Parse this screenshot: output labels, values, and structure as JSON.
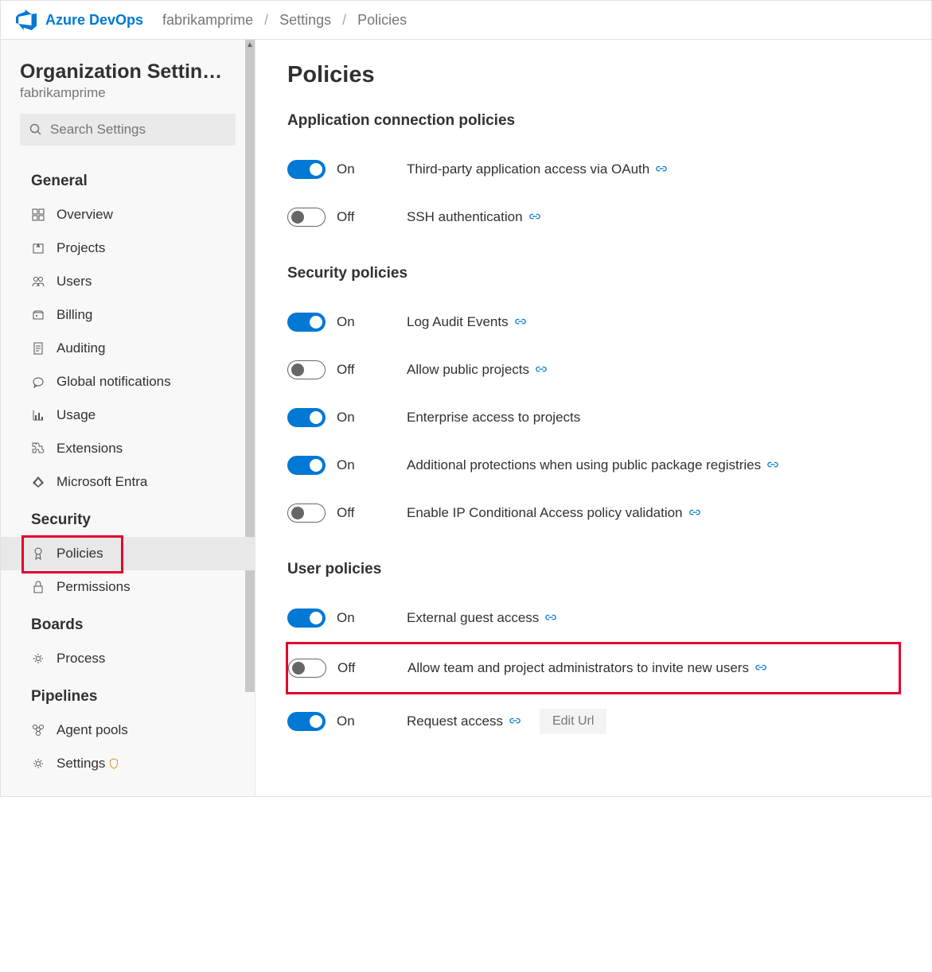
{
  "breadcrumb": {
    "product": "Azure DevOps",
    "org": "fabrikamprime",
    "settings": "Settings",
    "policies": "Policies"
  },
  "sidebar": {
    "title": "Organization Settin…",
    "subtitle": "fabrikamprime",
    "search_placeholder": "Search Settings",
    "sections": {
      "general": "General",
      "security": "Security",
      "boards": "Boards",
      "pipelines": "Pipelines"
    },
    "items": {
      "overview": "Overview",
      "projects": "Projects",
      "users": "Users",
      "billing": "Billing",
      "auditing": "Auditing",
      "global_notifications": "Global notifications",
      "usage": "Usage",
      "extensions": "Extensions",
      "entra": "Microsoft Entra",
      "policies": "Policies",
      "permissions": "Permissions",
      "process": "Process",
      "agent_pools": "Agent pools",
      "settings": "Settings"
    }
  },
  "main": {
    "title": "Policies",
    "sections": {
      "app_conn": "Application connection policies",
      "security": "Security policies",
      "user": "User policies"
    },
    "toggle_on": "On",
    "toggle_off": "Off",
    "policies": {
      "oauth": "Third-party application access via OAuth",
      "ssh": "SSH authentication",
      "audit": "Log Audit Events",
      "public_projects": "Allow public projects",
      "enterprise_access": "Enterprise access to projects",
      "package_registries": "Additional protections when using public package registries",
      "ip_ca": "Enable IP Conditional Access policy validation",
      "guest_access": "External guest access",
      "invite_users": "Allow team and project administrators to invite new users",
      "request_access": "Request access"
    },
    "edit_url": "Edit Url"
  }
}
